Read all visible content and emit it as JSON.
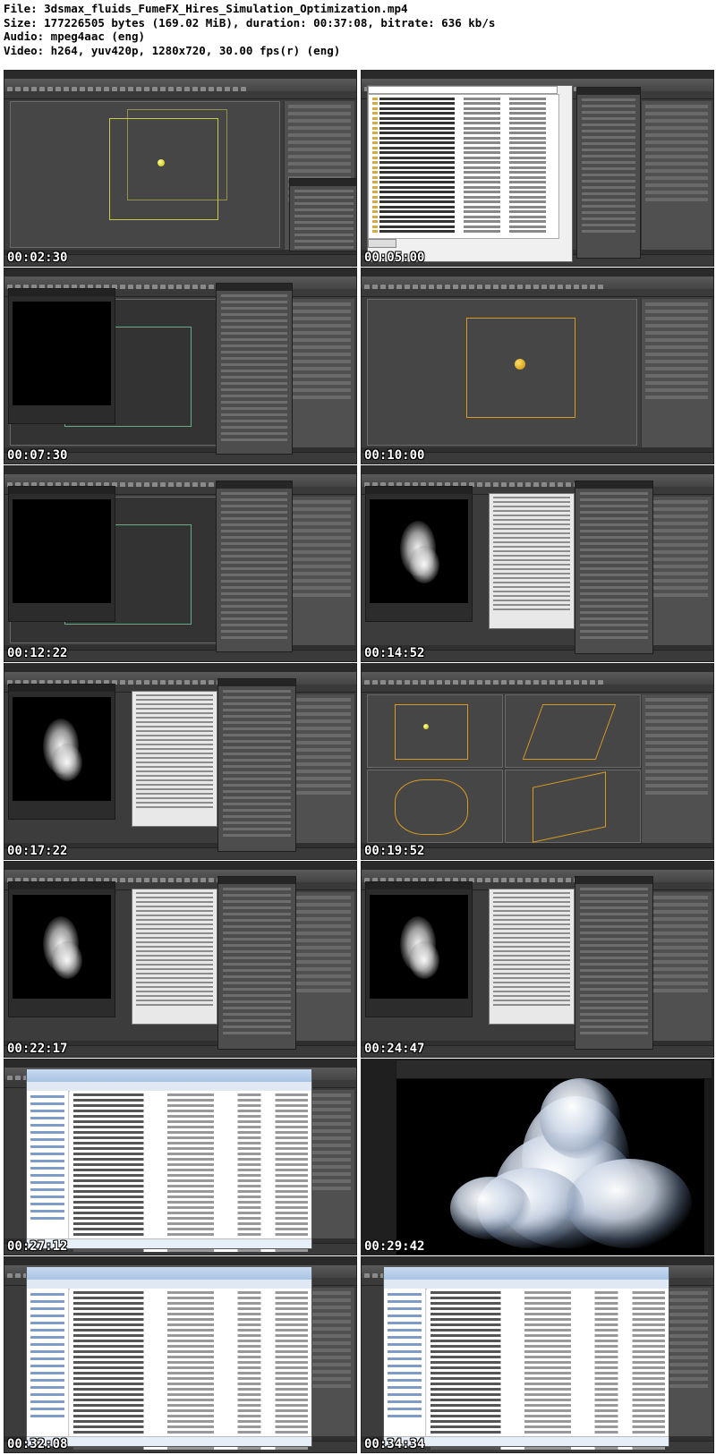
{
  "header": {
    "file": "File: 3dsmax_fluids_FumeFX_Hires_Simulation_Optimization.mp4",
    "size": "Size: 177226505 bytes (169.02 MiB), duration: 00:37:08, bitrate: 636 kb/s",
    "audio": "Audio: mpeg4aac (eng)",
    "video": "Video: h264, yuv420p, 1280x720, 30.00 fps(r) (eng)"
  },
  "thumbnails": [
    {
      "timestamp": "00:02:30",
      "scene": "viewport-sphere"
    },
    {
      "timestamp": "00:05:00",
      "scene": "save-dialog"
    },
    {
      "timestamp": "00:07:30",
      "scene": "render-black-fumefx"
    },
    {
      "timestamp": "00:10:00",
      "scene": "viewport-orange"
    },
    {
      "timestamp": "00:12:22",
      "scene": "render-black-fumefx"
    },
    {
      "timestamp": "00:14:52",
      "scene": "smoke-small-log"
    },
    {
      "timestamp": "00:17:22",
      "scene": "smoke-small-log"
    },
    {
      "timestamp": "00:19:52",
      "scene": "quad-viewports"
    },
    {
      "timestamp": "00:22:17",
      "scene": "smoke-small-log"
    },
    {
      "timestamp": "00:24:47",
      "scene": "smoke-small-log"
    },
    {
      "timestamp": "00:27:12",
      "scene": "explorer"
    },
    {
      "timestamp": "00:29:42",
      "scene": "big-smoke-render"
    },
    {
      "timestamp": "00:32:08",
      "scene": "explorer"
    },
    {
      "timestamp": "00:34:34",
      "scene": "explorer"
    }
  ]
}
